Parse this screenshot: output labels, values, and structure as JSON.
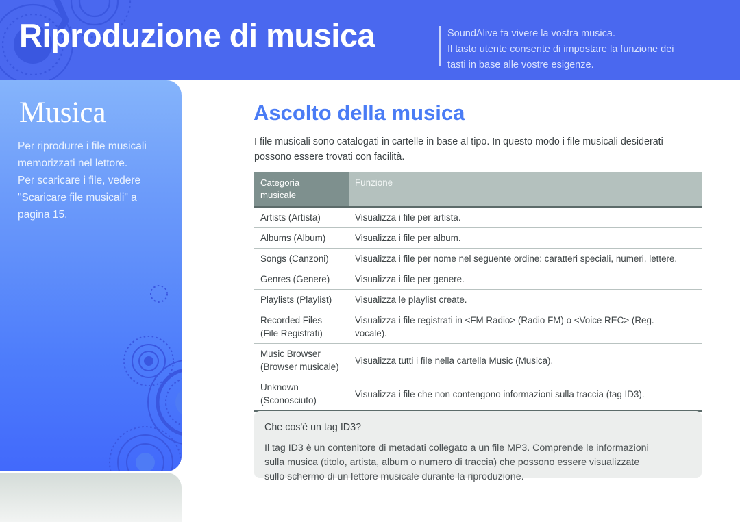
{
  "banner": {
    "title": "Riproduzione di musica",
    "note_lines": [
      "SoundAlive fa vivere la vostra musica.",
      "Il tasto utente consente di impostare la funzione dei",
      "tasti in base alle vostre esigenze."
    ],
    "bg_color": "#4a68ef",
    "title_color": "#ffffff",
    "note_color": "#d7e0fd"
  },
  "sidebar": {
    "title": "Musica",
    "body_lines": [
      "Per riprodurre i file musicali",
      "memorizzati nel lettore.",
      "Per scaricare i file, vedere",
      "\"Scaricare file musicali\" a",
      "pagina 15."
    ],
    "gradient_from": "#85b4fb",
    "gradient_to": "#4269fb"
  },
  "main": {
    "heading": "Ascolto della musica",
    "heading_color": "#4a7cf5",
    "intro_lines": [
      "I file musicali sono catalogati in cartelle in base al tipo. In questo modo i file musicali desiderati",
      "possono essere trovati con facilità."
    ]
  },
  "table": {
    "header": {
      "col1_line1": "Categoria",
      "col1_line2": "musicale",
      "col2": "Funzione",
      "col1_bg": "#7e908e",
      "col2_bg": "#b4c1be"
    },
    "category_color": "#5b93e8",
    "rows": [
      {
        "category_line1": "Artists (Artista)",
        "category_line2": "",
        "function_line1": "Visualizza i file per artista.",
        "function_line2": ""
      },
      {
        "category_line1": "Albums (Album)",
        "category_line2": "",
        "function_line1": "Visualizza i file per album.",
        "function_line2": ""
      },
      {
        "category_line1": "Songs (Canzoni)",
        "category_line2": "",
        "function_line1": "Visualizza i file per nome nel seguente ordine: caratteri speciali, numeri, lettere.",
        "function_line2": ""
      },
      {
        "category_line1": "Genres (Genere)",
        "category_line2": "",
        "function_line1": "Visualizza i file per genere.",
        "function_line2": ""
      },
      {
        "category_line1": "Playlists (Playlist)",
        "category_line2": "",
        "function_line1": "Visualizza le playlist create.",
        "function_line2": ""
      },
      {
        "category_line1": "Recorded Files",
        "category_line2": "(File Registrati)",
        "function_line1": "Visualizza i file registrati in <FM Radio> (Radio FM) o <Voice REC> (Reg.",
        "function_line2": "vocale)."
      },
      {
        "category_line1": "Music Browser",
        "category_line2": "(Browser musicale)",
        "function_line1": "Visualizza tutti i file nella cartella Music (Musica).",
        "function_line2": ""
      },
      {
        "category_line1": "Unknown",
        "category_line2": "(Sconosciuto)",
        "function_line1": "Visualizza i file che non contengono informazioni sulla traccia (tag ID3).",
        "function_line2": ""
      }
    ]
  },
  "note": {
    "title": "Che cos'è un tag ID3?",
    "body_lines": [
      "Il tag ID3 è un contenitore di metadati collegato a un file MP3. Comprende le informazioni",
      "sulla musica (titolo, artista, album o numero di traccia) che possono essere visualizzate",
      "sullo schermo di un lettore musicale durante la riproduzione."
    ],
    "bg_color": "#eceeed"
  }
}
